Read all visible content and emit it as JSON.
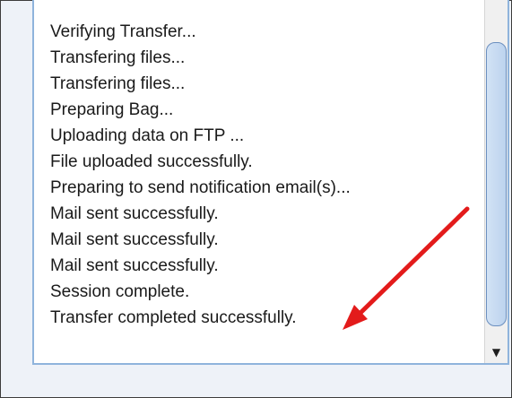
{
  "log": {
    "lines": [
      "Verifying Transfer...",
      "Transfering files...",
      "Transfering files...",
      "Preparing Bag...",
      "Uploading data on FTP ...",
      "File uploaded successfully.",
      "Preparing to send notification email(s)...",
      "Mail sent successfully.",
      "Mail sent successfully.",
      "Mail sent successfully.",
      "Session complete.",
      "Transfer completed successfully."
    ]
  },
  "scrollbar": {
    "down_icon": "down-arrow-icon",
    "down_glyph": "▼"
  },
  "annotation": {
    "arrow_color": "#e31b1b"
  }
}
